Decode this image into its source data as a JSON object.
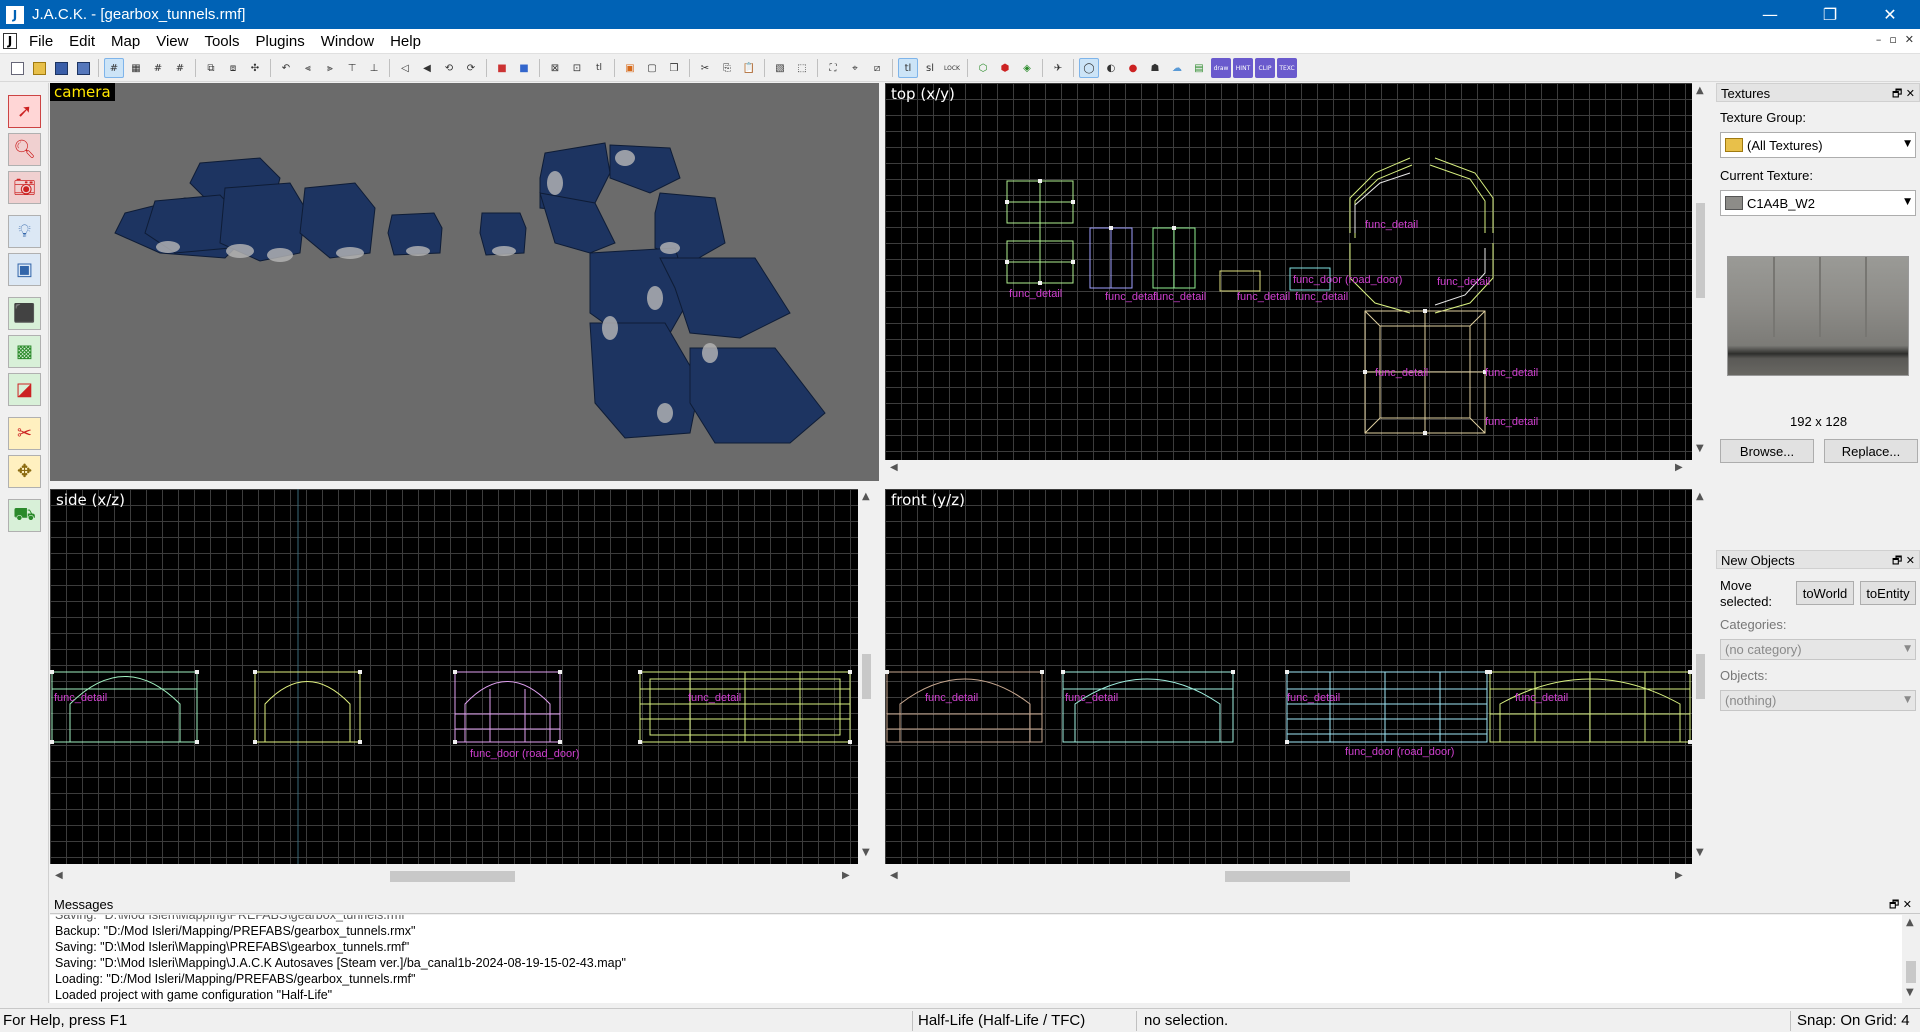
{
  "window": {
    "title": "J.A.C.K. - [gearbox_tunnels.rmf]",
    "app_letter": "J",
    "minimize": "—",
    "maximize": "❐",
    "close": "✕"
  },
  "menu": [
    "File",
    "Edit",
    "Map",
    "View",
    "Tools",
    "Plugins",
    "Window",
    "Help"
  ],
  "mdi": {
    "minimize": "–",
    "restore": "▫",
    "close": "✕"
  },
  "toolbar": {
    "labels": {
      "tl": "tl",
      "sl": "sl",
      "lock": "LOCK",
      "draw": "draw",
      "hint": "HINT",
      "clip": "CLIP",
      "tex": "TEXC"
    }
  },
  "viewports": {
    "camera": "camera",
    "top": "top (x/y)",
    "side": "side (x/z)",
    "front": "front (y/z)"
  },
  "entity_labels": {
    "func_detail": "func_detail",
    "func_door": "func_door (road_door)"
  },
  "messages": {
    "title": "Messages",
    "lines": [
      "Saving: \"D:\\Mod Isleri\\Mapping\\PREFABS\\gearbox_tunnels.rmf\"",
      "Backup: \"D:/Mod Isleri/Mapping/PREFABS/gearbox_tunnels.rmx\"",
      "Saving: \"D:\\Mod Isleri\\Mapping\\PREFABS\\gearbox_tunnels.rmf\"",
      "Saving: \"D:\\Mod Isleri\\Mapping\\J.A.C.K Autosaves [Steam ver.]/ba_canal1b-2024-08-19-15-02-43.map\"",
      "Loading: \"D:/Mod Isleri/Mapping/PREFABS/gearbox_tunnels.rmf\"",
      "Loaded project with game configuration \"Half-Life\""
    ]
  },
  "status": {
    "help": "For Help, press F1",
    "game": "Half-Life (Half-Life / TFC)",
    "selection": "no selection.",
    "snap": "Snap: On Grid: 4"
  },
  "textures": {
    "title": "Textures",
    "group_label": "Texture Group:",
    "group_value": "(All Textures)",
    "current_label": "Current Texture:",
    "current_value": "C1A4B_W2",
    "size": "192 x 128",
    "browse": "Browse...",
    "replace": "Replace..."
  },
  "new_objects": {
    "title": "New Objects",
    "move_label": "Move selected:",
    "to_world": "toWorld",
    "to_entity": "toEntity",
    "categories_label": "Categories:",
    "categories_value": "(no category)",
    "objects_label": "Objects:",
    "objects_value": "(nothing)"
  },
  "colors": {
    "titlebar": "#0062b5",
    "camera_bg": "#6b6b6b",
    "brush_blue": "#1d3461",
    "entity_magenta": "#d040d0"
  }
}
